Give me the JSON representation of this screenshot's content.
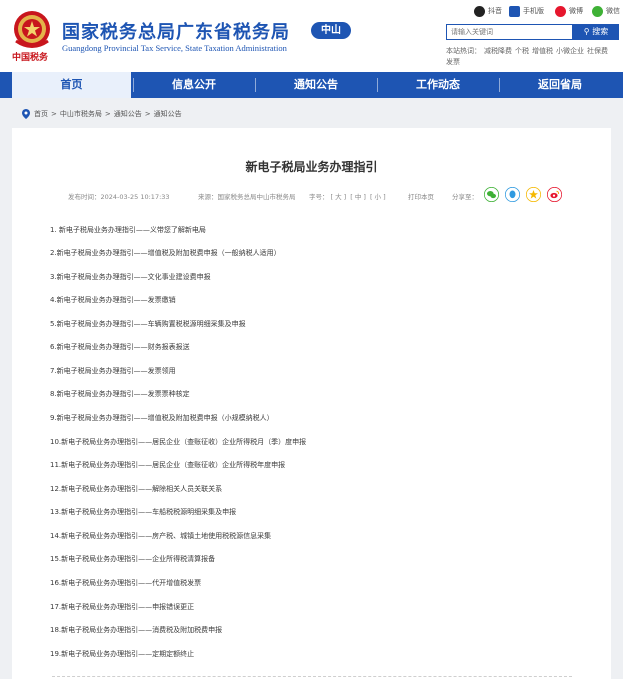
{
  "header": {
    "title": "国家税务总局广东省税务局",
    "subtitle": "Guangdong Provincial Tax Service, State Taxation Administration",
    "city_badge": "中山",
    "emblem_text": "中国税务",
    "social": {
      "douyin": "抖音",
      "mobile": "手机版",
      "weibo": "微博",
      "wechat": "微信"
    },
    "search": {
      "placeholder": "请输入关键词",
      "button": "搜索"
    },
    "hot_words_label": "本站热词：",
    "hot_words": [
      "减税降费",
      "个税",
      "增值税",
      "小微企业",
      "社保费",
      "发票"
    ]
  },
  "nav": {
    "items": [
      {
        "label": "首页"
      },
      {
        "label": "信息公开"
      },
      {
        "label": "通知公告"
      },
      {
        "label": "工作动态"
      },
      {
        "label": "返回省局"
      }
    ]
  },
  "breadcrumb": {
    "items": [
      "首页",
      "中山市税务局",
      "通知公告",
      "通知公告"
    ],
    "separator": ">"
  },
  "article": {
    "title": "新电子税局业务办理指引",
    "publish_time": "发布时间：2024-03-25 10:17:33",
    "source": "来源：国家税务总局中山市税务局",
    "font_size_label": "字号：",
    "font_sizes": [
      "[ 大 ]",
      "[ 中 ]",
      "[ 小 ]"
    ],
    "print": "打印本页",
    "share_label": "分享至：",
    "items": [
      "1. 新电子税局业务办理指引——义带您了解新电局",
      "2.新电子税局业务办理指引——增值税及附加税费申报（一般纳税人适用）",
      "3.新电子税局业务办理指引——文化事业建设费申报",
      "4.新电子税局业务办理指引——发票缴销",
      "5.新电子税局业务办理指引——车辆购置税税源明细采集及申报",
      "6.新电子税局业务办理指引——财务报表报送",
      "7.新电子税局业务办理指引——发票领用",
      "8.新电子税局业务办理指引——发票票种核定",
      "9.新电子税局业务办理指引——增值税及附加税费申报（小规模纳税人）",
      "10.新电子税局业务办理指引——居民企业（查账征收）企业所得税月（季）度申报",
      "11.新电子税局业务办理指引——居民企业（查账征收）企业所得税年度申报",
      "12.新电子税局业务办理指引——解除相关人员关联关系",
      "13.新电子税局业务办理指引——车船税税源明细采集及申报",
      "14.新电子税局业务办理指引——房产税、城镇土地使用税税源信息采集",
      "15.新电子税局业务办理指引——企业所得税清算报备",
      "16.新电子税局业务办理指引——代开增值税发票",
      "17.新电子税局业务办理指引——申报错误更正",
      "18.新电子税局业务办理指引——消费税及附加税费申报",
      "19.新电子税局业务办理指引——定期定额终止"
    ]
  },
  "colors": {
    "brand_blue": "#1e55b3",
    "emblem_red": "#c8161d",
    "wechat_green": "#3eb135",
    "qq_blue": "#2f9ae0",
    "qzone_yellow": "#f5b800",
    "weibo_red": "#e6162d"
  }
}
